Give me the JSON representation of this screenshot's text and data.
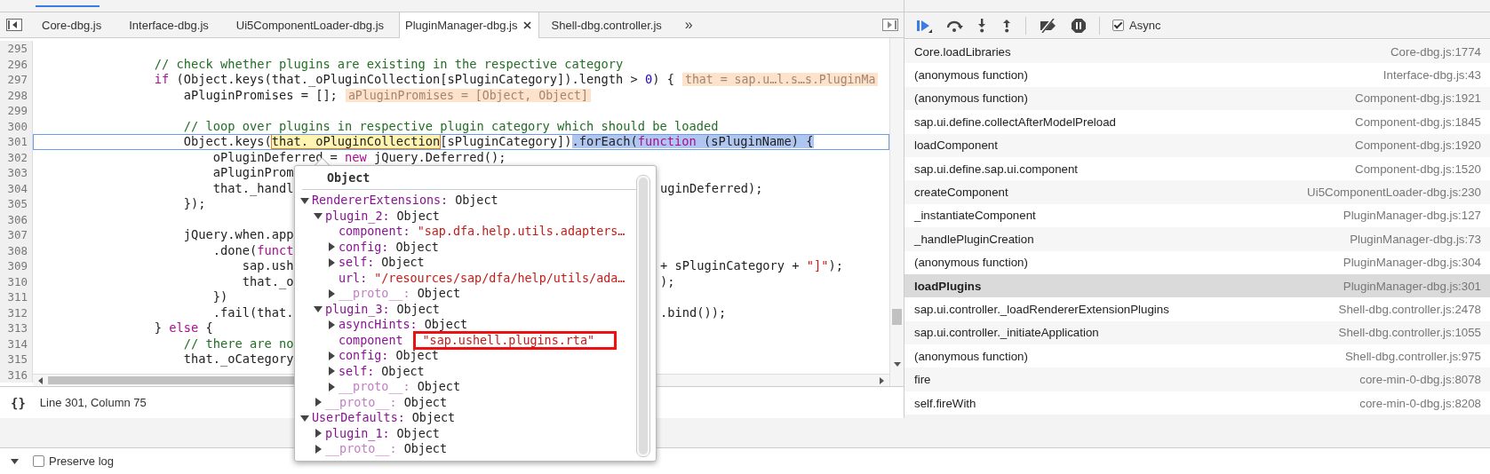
{
  "editor": {
    "tabs": [
      {
        "label": "Core-dbg.js",
        "selected": false,
        "closable": false
      },
      {
        "label": "Interface-dbg.js",
        "selected": false,
        "closable": false
      },
      {
        "label": "Ui5ComponentLoader-dbg.js",
        "selected": false,
        "closable": false
      },
      {
        "label": "PluginManager-dbg.js",
        "selected": true,
        "closable": true
      },
      {
        "label": "Shell-dbg.controller.js",
        "selected": false,
        "closable": false
      }
    ],
    "more_tabs": "»",
    "lines": [
      {
        "number": "295",
        "current": false
      },
      {
        "number": "296",
        "current": false,
        "segments": [
          {
            "text": "                // check whether plugins are existing in the respective category",
            "kind": "comment"
          }
        ]
      },
      {
        "number": "297",
        "current": false,
        "segments": [
          {
            "text": "                if",
            "kind": "keyword"
          },
          {
            "text": " (Object.keys(that._oPluginCollection[sPluginCategory]).length > ",
            "kind": "plain"
          },
          {
            "text": "0",
            "kind": "number"
          },
          {
            "text": ") {",
            "kind": "plain"
          }
        ],
        "annotation": "that = sap.u…l.s…s.PluginMa"
      },
      {
        "number": "298",
        "current": false,
        "segments": [
          {
            "text": "                    aPluginPromises = [];",
            "kind": "plain"
          }
        ],
        "annotation": "aPluginPromises = [Object, Object]"
      },
      {
        "number": "299",
        "current": false
      },
      {
        "number": "300",
        "current": false,
        "segments": [
          {
            "text": "                    // loop over plugins in respective plugin category which should be loaded",
            "kind": "comment"
          }
        ]
      },
      {
        "number": "301",
        "current": true,
        "segments": [
          {
            "text": "                    Object.keys(",
            "kind": "plain"
          },
          {
            "text": "that._oPluginCollection",
            "kind": "hover"
          },
          {
            "text": "[sPluginCategory])",
            "kind": "plain"
          },
          {
            "text": ".forEach(",
            "kind": "selection"
          },
          {
            "text": "function",
            "kind": "selection-keyword"
          },
          {
            "text": " (sPluginName) {",
            "kind": "selection"
          }
        ]
      },
      {
        "number": "302",
        "current": false,
        "segments": [
          {
            "text": "                        oPluginDeferred = ",
            "kind": "plain"
          },
          {
            "text": "new",
            "kind": "keyword"
          },
          {
            "text": " jQuery.Deferred();",
            "kind": "plain"
          }
        ]
      },
      {
        "number": "303",
        "current": false,
        "segments": [
          {
            "text": "                        aPluginProm",
            "kind": "plain"
          }
        ]
      },
      {
        "number": "304",
        "current": false,
        "segments": [
          {
            "text": "                        that._handl",
            "kind": "plain"
          }
        ],
        "right": [
          {
            "text": "uginDeferred);",
            "kind": "plain"
          }
        ]
      },
      {
        "number": "305",
        "current": false,
        "segments": [
          {
            "text": "                    });",
            "kind": "plain"
          }
        ]
      },
      {
        "number": "306",
        "current": false
      },
      {
        "number": "307",
        "current": false,
        "segments": [
          {
            "text": "                    jQuery.when.app",
            "kind": "plain"
          }
        ]
      },
      {
        "number": "308",
        "current": false,
        "segments": [
          {
            "text": "                        .done(",
            "kind": "plain"
          },
          {
            "text": "funct",
            "kind": "keyword"
          }
        ]
      },
      {
        "number": "309",
        "current": false,
        "segments": [
          {
            "text": "                            sap.ush",
            "kind": "plain"
          }
        ],
        "right": [
          {
            "text": "+ sPluginCategory + ",
            "kind": "plain"
          },
          {
            "text": "\"]\"",
            "kind": "string"
          },
          {
            "text": ");",
            "kind": "plain"
          }
        ]
      },
      {
        "number": "310",
        "current": false,
        "segments": [
          {
            "text": "                            that._o",
            "kind": "plain"
          }
        ],
        "right": [
          {
            "text": ");",
            "kind": "plain"
          }
        ]
      },
      {
        "number": "311",
        "current": false,
        "segments": [
          {
            "text": "                        })",
            "kind": "plain"
          }
        ]
      },
      {
        "number": "312",
        "current": false,
        "segments": [
          {
            "text": "                        .fail(that.",
            "kind": "plain"
          }
        ],
        "right": [
          {
            "text": ".bind());",
            "kind": "plain"
          }
        ]
      },
      {
        "number": "313",
        "current": false,
        "segments": [
          {
            "text": "                } ",
            "kind": "plain"
          },
          {
            "text": "else",
            "kind": "keyword"
          },
          {
            "text": " {",
            "kind": "plain"
          }
        ]
      },
      {
        "number": "314",
        "current": false,
        "segments": [
          {
            "text": "                    // there are no",
            "kind": "comment"
          }
        ]
      },
      {
        "number": "315",
        "current": false,
        "segments": [
          {
            "text": "                    that._oCategory",
            "kind": "plain"
          }
        ]
      },
      {
        "number": "316",
        "current": false
      }
    ],
    "pretty_print": "{}",
    "status": "Line 301, Column 75"
  },
  "popup": {
    "title": "Object",
    "tree": [
      {
        "key": "RendererExtensions:",
        "value": "Object",
        "kind": "object",
        "expanded": true,
        "highlighted": false,
        "children": [
          {
            "key": "plugin_2:",
            "value": "Object",
            "kind": "object",
            "expanded": true,
            "highlighted": false,
            "children": [
              {
                "key": "component:",
                "value": "\"sap.dfa.help.utils.adapters…",
                "kind": "leaf",
                "highlighted": false
              },
              {
                "key": "config:",
                "value": "Object",
                "kind": "object",
                "expanded": false,
                "highlighted": false
              },
              {
                "key": "self:",
                "value": "Object",
                "kind": "object",
                "expanded": false,
                "highlighted": false
              },
              {
                "key": "url:",
                "value": "\"/resources/sap/dfa/help/utils/ada…",
                "kind": "leaf",
                "highlighted": false
              },
              {
                "key": "__proto__:",
                "value": "Object",
                "kind": "proto",
                "expanded": false,
                "highlighted": false
              }
            ]
          },
          {
            "key": "plugin_3:",
            "value": "Object",
            "kind": "object",
            "expanded": true,
            "highlighted": false,
            "children": [
              {
                "key": "asyncHints:",
                "value": "Object",
                "kind": "object",
                "expanded": false,
                "highlighted": false
              },
              {
                "key": "component",
                "value": "\"sap.ushell.plugins.rta\"",
                "kind": "leaf",
                "highlighted": true
              },
              {
                "key": "config:",
                "value": "Object",
                "kind": "object",
                "expanded": false,
                "highlighted": false
              },
              {
                "key": "self:",
                "value": "Object",
                "kind": "object",
                "expanded": false,
                "highlighted": false
              },
              {
                "key": "__proto__:",
                "value": "Object",
                "kind": "proto",
                "expanded": false,
                "highlighted": false
              }
            ]
          },
          {
            "key": "__proto__:",
            "value": "Object",
            "kind": "proto",
            "expanded": false,
            "highlighted": false
          }
        ]
      },
      {
        "key": "UserDefaults:",
        "value": "Object",
        "kind": "object",
        "expanded": true,
        "highlighted": false,
        "children": [
          {
            "key": "plugin_1:",
            "value": "Object",
            "kind": "object",
            "expanded": false,
            "highlighted": false
          },
          {
            "key": "__proto__:",
            "value": "Object",
            "kind": "proto",
            "expanded": false,
            "highlighted": false
          }
        ]
      }
    ]
  },
  "debugger": {
    "async": {
      "label": "Async",
      "checked": true
    },
    "call_stack": [
      {
        "function": "Core.loadLibraries",
        "location": "Core-dbg.js:1774",
        "selected": false
      },
      {
        "function": "(anonymous function)",
        "location": "Interface-dbg.js:43",
        "selected": false
      },
      {
        "function": "(anonymous function)",
        "location": "Component-dbg.js:1921",
        "selected": false
      },
      {
        "function": "sap.ui.define.collectAfterModelPreload",
        "location": "Component-dbg.js:1845",
        "selected": false
      },
      {
        "function": "loadComponent",
        "location": "Component-dbg.js:1920",
        "selected": false
      },
      {
        "function": "sap.ui.define.sap.ui.component",
        "location": "Component-dbg.js:1520",
        "selected": false
      },
      {
        "function": "createComponent",
        "location": "Ui5ComponentLoader-dbg.js:230",
        "selected": false
      },
      {
        "function": "_instantiateComponent",
        "location": "PluginManager-dbg.js:127",
        "selected": false
      },
      {
        "function": "_handlePluginCreation",
        "location": "PluginManager-dbg.js:73",
        "selected": false
      },
      {
        "function": "(anonymous function)",
        "location": "PluginManager-dbg.js:304",
        "selected": false
      },
      {
        "function": "loadPlugins",
        "location": "PluginManager-dbg.js:301",
        "selected": true
      },
      {
        "function": "sap.ui.controller._loadRendererExtensionPlugins",
        "location": "Shell-dbg.controller.js:2478",
        "selected": false
      },
      {
        "function": "sap.ui.controller._initiateApplication",
        "location": "Shell-dbg.controller.js:1055",
        "selected": false
      },
      {
        "function": "(anonymous function)",
        "location": "Shell-dbg.controller.js:975",
        "selected": false
      },
      {
        "function": "fire",
        "location": "core-min-0-dbg.js:8078",
        "selected": false
      },
      {
        "function": "self.fireWith",
        "location": "core-min-0-dbg.js:8208",
        "selected": false
      }
    ]
  },
  "console": {
    "preserve_log": {
      "label": "Preserve log",
      "checked": false
    }
  }
}
